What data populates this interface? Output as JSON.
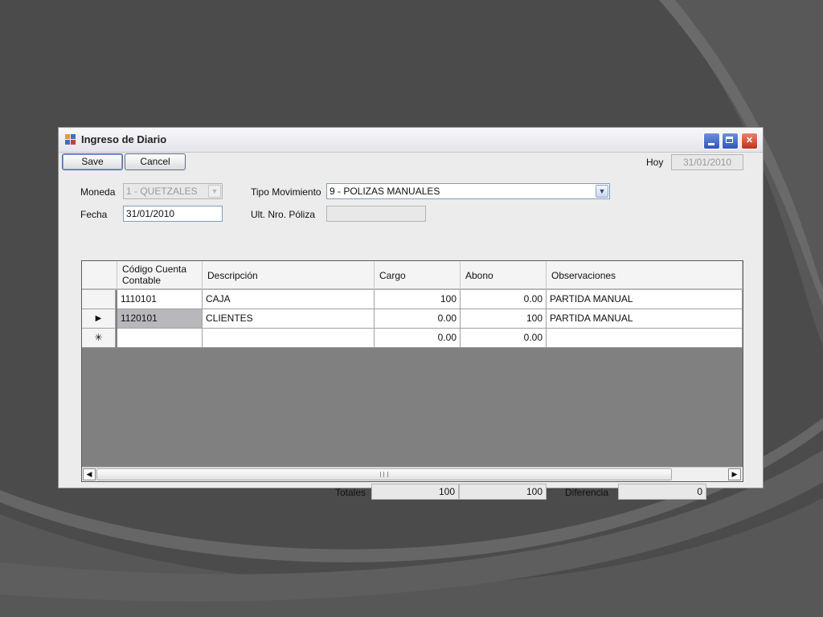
{
  "window": {
    "title": "Ingreso de Diario"
  },
  "toolbar": {
    "save_label": "Save",
    "cancel_label": "Cancel"
  },
  "hoy": {
    "label": "Hoy",
    "value": "31/01/2010"
  },
  "form": {
    "moneda_label": "Moneda",
    "moneda_value": "1 - QUETZALES",
    "fecha_label": "Fecha",
    "fecha_value": "31/01/2010",
    "tipo_movimiento_label": "Tipo Movimiento",
    "tipo_movimiento_value": "9 - POLIZAS MANUALES",
    "ult_poliza_label": "Ult. Nro. Póliza",
    "ult_poliza_value": ""
  },
  "grid": {
    "columns": [
      "Código Cuenta\nContable",
      "Descripción",
      "Cargo",
      "Abono",
      "Observaciones"
    ],
    "rows": [
      {
        "marker": "",
        "codigo": "1110101",
        "descripcion": "CAJA",
        "cargo": "100",
        "abono": "0.00",
        "observaciones": "PARTIDA MANUAL"
      },
      {
        "marker": "▶",
        "codigo": "1120101",
        "descripcion": "CLIENTES",
        "cargo": "0.00",
        "abono": "100",
        "observaciones": "PARTIDA MANUAL"
      },
      {
        "marker": "✳",
        "codigo": "",
        "descripcion": "",
        "cargo": "0.00",
        "abono": "0.00",
        "observaciones": ""
      }
    ],
    "scroll_left": "◀",
    "scroll_right": "▶"
  },
  "totals": {
    "totales_label": "Totales",
    "cargo_total": "100",
    "abono_total": "100",
    "diferencia_label": "Diferencia",
    "diferencia_value": "0"
  },
  "icons": {
    "app": "form-icon",
    "minimize": "minimize-icon",
    "maximize": "maximize-icon",
    "close": "close-icon",
    "dropdown": "chevron-down-icon"
  },
  "colors": {
    "background": "#4c4c4c",
    "title_close": "#c2301c",
    "title_buttons": "#2f55c0"
  }
}
